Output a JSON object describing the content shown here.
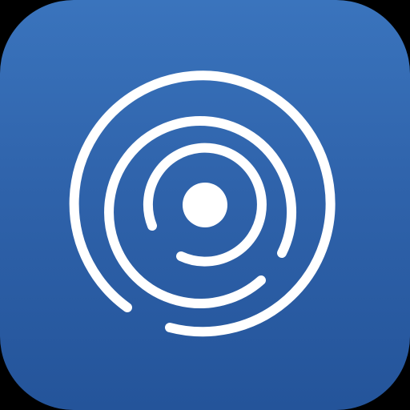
{
  "app_icon": {
    "icon": "radar-target-icon",
    "colors": {
      "background_top": "#3a74bd",
      "background_bottom": "#24549a",
      "glyph": "#ffffff",
      "outside": "#000000"
    }
  }
}
